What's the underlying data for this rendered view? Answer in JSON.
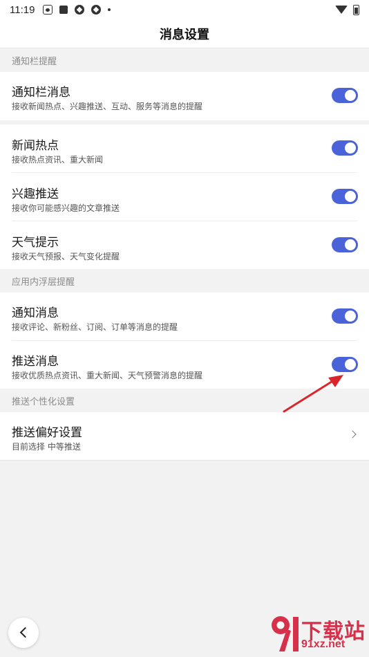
{
  "status_bar": {
    "time": "11:19",
    "icons_left": [
      "paw-icon",
      "square-icon",
      "shutter-icon",
      "shutter-icon",
      "dot-icon"
    ],
    "icons_right": [
      "wifi-icon",
      "battery-icon"
    ]
  },
  "header": {
    "title": "消息设置"
  },
  "sections": [
    {
      "header": "通知栏提醒",
      "rows": [
        {
          "title": "通知栏消息",
          "subtitle": "接收新闻热点、兴趣推送、互动、服务等消息的提醒",
          "toggle_on": true
        }
      ]
    },
    {
      "header": "",
      "rows": [
        {
          "title": "新闻热点",
          "subtitle": "接收热点资讯、重大新闻",
          "toggle_on": true
        },
        {
          "title": "兴趣推送",
          "subtitle": "接收你可能感兴趣的文章推送",
          "toggle_on": true
        },
        {
          "title": "天气提示",
          "subtitle": "接收天气预报、天气变化提醒",
          "toggle_on": true
        }
      ]
    },
    {
      "header": "应用内浮层提醒",
      "rows": [
        {
          "title": "通知消息",
          "subtitle": "接收评论、新粉丝、订阅、订单等消息的提醒",
          "toggle_on": true
        },
        {
          "title": "推送消息",
          "subtitle": "接收优质热点资讯、重大新闻、天气预警消息的提醒",
          "toggle_on": true
        }
      ]
    },
    {
      "header": "推送个性化设置",
      "rows": [
        {
          "title": "推送偏好设置",
          "subtitle": "目前选择 中等推送",
          "chevron": true
        }
      ]
    }
  ],
  "colors": {
    "toggle_on": "#4a63d8",
    "annotation_arrow": "#d9262b",
    "watermark": "#d6304a"
  },
  "watermark": {
    "logo_text": "下载站",
    "url": "91xz.net"
  }
}
